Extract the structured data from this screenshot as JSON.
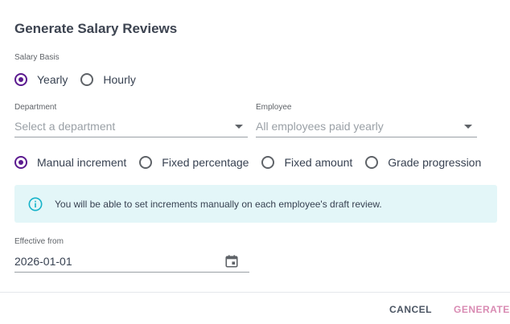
{
  "dialog": {
    "title": "Generate Salary Reviews"
  },
  "salary_basis": {
    "label": "Salary Basis",
    "options": [
      {
        "label": "Yearly",
        "checked": true
      },
      {
        "label": "Hourly",
        "checked": false
      }
    ]
  },
  "department": {
    "label": "Department",
    "placeholder": "Select a department"
  },
  "employee": {
    "label": "Employee",
    "placeholder": "All employees paid yearly"
  },
  "increment_method": {
    "options": [
      {
        "label": "Manual increment",
        "checked": true
      },
      {
        "label": "Fixed percentage",
        "checked": false
      },
      {
        "label": "Fixed amount",
        "checked": false
      },
      {
        "label": "Grade progression",
        "checked": false
      }
    ]
  },
  "info": {
    "icon": "info-icon",
    "text": "You will be able to set increments manually on each employee's draft review."
  },
  "effective_from": {
    "label": "Effective from",
    "value": "2026-01-01",
    "icon": "calendar-icon"
  },
  "footer": {
    "cancel_label": "CANCEL",
    "generate_label": "GENERATE"
  },
  "colors": {
    "accent": "#5b1a8f",
    "info_bg": "#e3f6f8",
    "info_icon": "#16b3c9",
    "generate_disabled": "#d98bb3"
  }
}
